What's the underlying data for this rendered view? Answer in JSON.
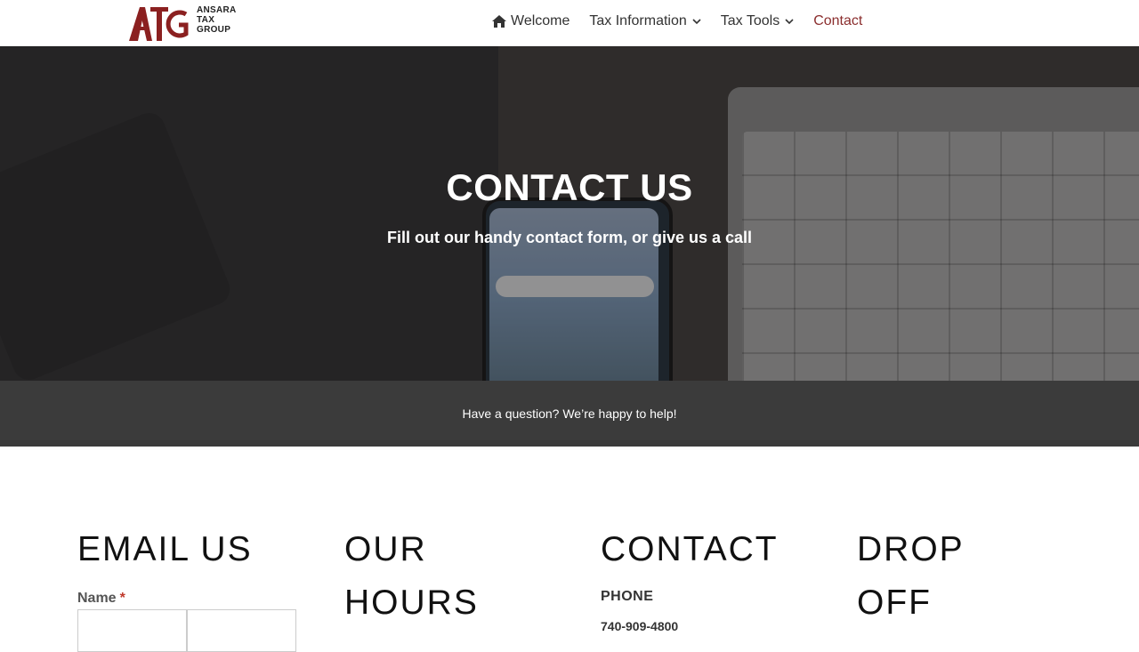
{
  "logo": {
    "mark": "ATG",
    "line1": "ANSARA",
    "line2": "TAX",
    "line3": "GROUP"
  },
  "nav": {
    "welcome": "Welcome",
    "tax_information": "Tax Information",
    "tax_tools": "Tax Tools",
    "contact": "Contact"
  },
  "hero": {
    "title": "CONTACT US",
    "subtitle": "Fill out our handy contact form, or give us a call"
  },
  "band": {
    "text": "Have a question? We’re happy to help!"
  },
  "columns": {
    "email_heading": "EMAIL US",
    "hours_heading_1": "OUR",
    "hours_heading_2": "HOURS",
    "contact_heading": "CONTACT",
    "drop_heading_1": "DROP",
    "drop_heading_2": "OFF"
  },
  "form": {
    "name_label": "Name",
    "required_mark": "*"
  },
  "contact": {
    "phone_label": "PHONE",
    "phone_number": "740-909-4800"
  },
  "colors": {
    "brand": "#8b2e2e",
    "band": "#3b3b3b"
  }
}
